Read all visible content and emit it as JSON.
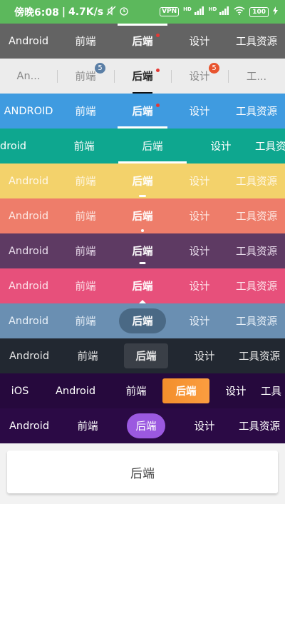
{
  "status_bar": {
    "time": "傍晚6:08",
    "network_speed": "4.7K/s",
    "vpn": "VPN",
    "network_type_1": "HD",
    "network_type_2": "HD",
    "battery": "100",
    "icons": [
      "mute-icon",
      "alarm-icon",
      "signal-icon",
      "wifi-icon",
      "charging-icon"
    ],
    "bg_color": "#5cb85c"
  },
  "row1": {
    "tabs": [
      "Android",
      "前端",
      "后端",
      "设计",
      "工具资源"
    ],
    "selected": 2
  },
  "row2": {
    "tabs": [
      "An...",
      "前端",
      "后端",
      "设计",
      "工..."
    ],
    "selected": 2,
    "badges": {
      "frontend": "5",
      "design": "5"
    }
  },
  "row3": {
    "tabs": [
      "ANDROID",
      "前端",
      "后端",
      "设计",
      "工具资源"
    ],
    "selected": 2
  },
  "row4": {
    "tabs": [
      "droid",
      "前端",
      "后端",
      "设计",
      "工具资"
    ],
    "selected": 2
  },
  "row5": {
    "tabs": [
      "Android",
      "前端",
      "后端",
      "设计",
      "工具资源"
    ],
    "selected": 2
  },
  "row6": {
    "tabs": [
      "Android",
      "前端",
      "后端",
      "设计",
      "工具资源"
    ],
    "selected": 2
  },
  "row7": {
    "tabs": [
      "Android",
      "前端",
      "后端",
      "设计",
      "工具资源"
    ],
    "selected": 2
  },
  "row8": {
    "tabs": [
      "Android",
      "前端",
      "后端",
      "设计",
      "工具资源"
    ],
    "selected": 2
  },
  "row9": {
    "tabs": [
      "Android",
      "前端",
      "后端",
      "设计",
      "工具资源"
    ],
    "selected": 2
  },
  "row10": {
    "tabs": [
      "Android",
      "前端",
      "后端",
      "设计",
      "工具资源"
    ],
    "selected": 2
  },
  "row11": {
    "tabs": [
      "iOS",
      "Android",
      "前端",
      "后端",
      "设计",
      "工具"
    ],
    "selected": 3
  },
  "row12": {
    "tabs": [
      "Android",
      "前端",
      "后端",
      "设计",
      "工具资源"
    ],
    "selected": 2
  },
  "content": {
    "card_label": "后端"
  },
  "colors": {
    "row1": "#636363",
    "row2": "#ececec",
    "row3": "#3f9be0",
    "row4": "#0ea78f",
    "row5": "#f3d26b",
    "row6": "#ee7d6a",
    "row7": "#5e3a63",
    "row8": "#e7507b",
    "row9": "#6a8fb2",
    "row10": "#222831",
    "row11": "#26093d",
    "row12": "#2b0a45",
    "dot": "#e53935",
    "badge_blue": "#5b7fa6",
    "badge_red": "#e8542f",
    "pill_orange": "#f38f2c",
    "pill_purple": "#9b59e0"
  }
}
